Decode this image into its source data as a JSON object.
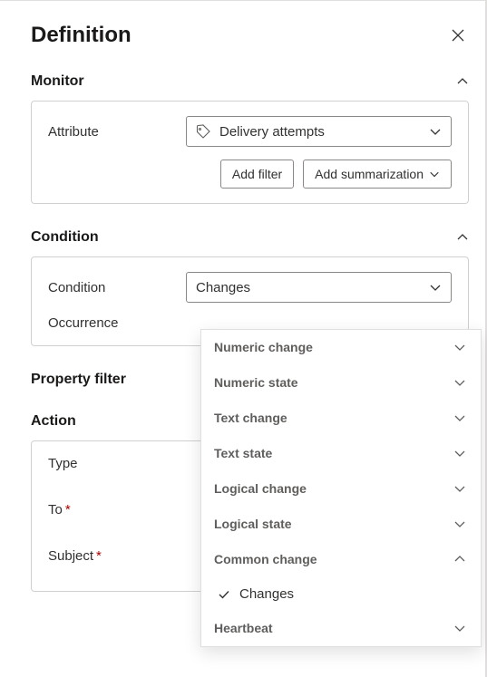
{
  "panel": {
    "title": "Definition"
  },
  "sections": {
    "monitor": {
      "title": "Monitor",
      "attribute_label": "Attribute",
      "attribute_value": "Delivery attempts",
      "add_filter": "Add filter",
      "add_summarization": "Add summarization"
    },
    "condition": {
      "title": "Condition",
      "condition_label": "Condition",
      "condition_value": "Changes",
      "occurrence_label": "Occurrence"
    },
    "property_filter": {
      "title": "Property filter"
    },
    "action": {
      "title": "Action",
      "type_label": "Type",
      "to_label": "To",
      "subject_label": "Subject"
    }
  },
  "condition_dropdown": {
    "groups": [
      {
        "label": "Numeric change",
        "expanded": false
      },
      {
        "label": "Numeric state",
        "expanded": false
      },
      {
        "label": "Text change",
        "expanded": false
      },
      {
        "label": "Text state",
        "expanded": false
      },
      {
        "label": "Logical change",
        "expanded": false
      },
      {
        "label": "Logical state",
        "expanded": false
      },
      {
        "label": "Common change",
        "expanded": true
      },
      {
        "label": "Heartbeat",
        "expanded": false
      }
    ],
    "selected_option": "Changes"
  }
}
